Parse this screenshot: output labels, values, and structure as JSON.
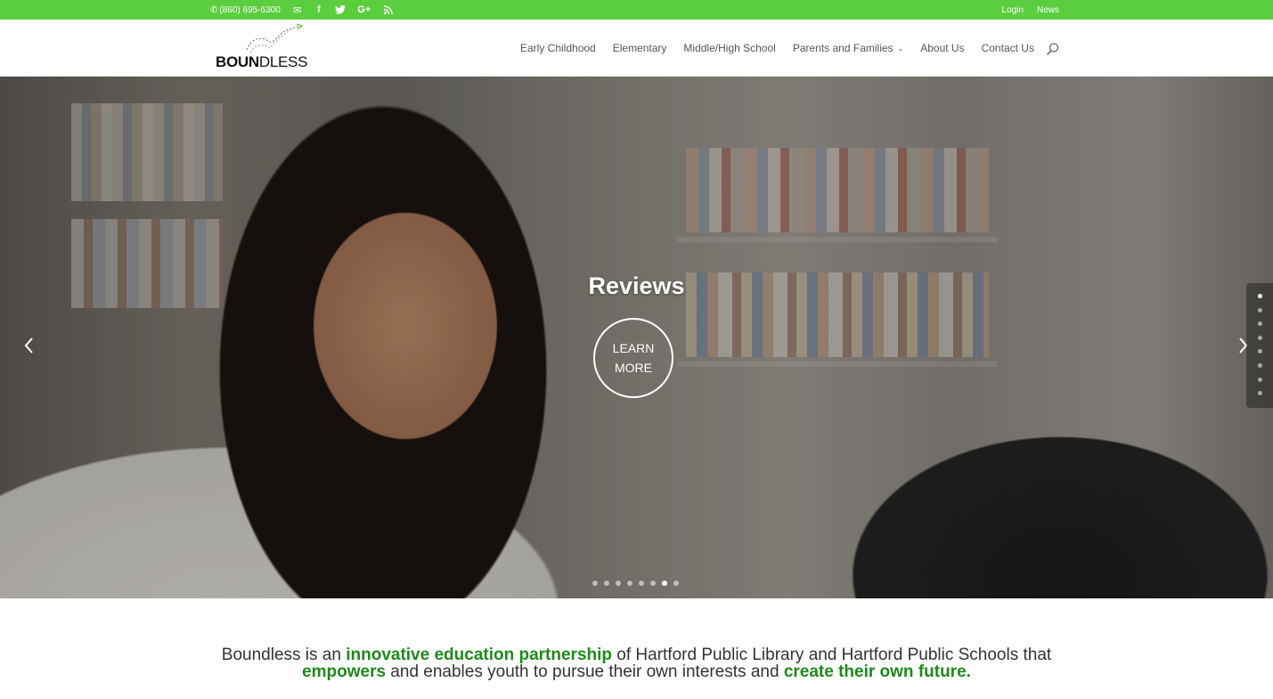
{
  "topbar": {
    "phone": "(860) 695-6300",
    "social_icons": [
      "email-icon",
      "facebook-icon",
      "twitter-icon",
      "google-plus-icon",
      "rss-icon"
    ],
    "links": [
      "Login",
      "News"
    ],
    "background": "#5bce3f"
  },
  "header": {
    "logo_text_bold": "BOUN",
    "logo_text_rest": "DLESS",
    "nav": [
      {
        "label": "Early Childhood"
      },
      {
        "label": "Elementary"
      },
      {
        "label": "Middle/High School"
      },
      {
        "label": "Parents and Families",
        "has_dropdown": true
      },
      {
        "label": "About Us"
      },
      {
        "label": "Contact Us"
      }
    ],
    "search_icon": "search-icon"
  },
  "hero": {
    "title": "Reviews",
    "button_line1": "LEARN",
    "button_line2": "MORE",
    "slide_count": 8,
    "active_slide_index": 6,
    "side_active_index": 0
  },
  "mission": {
    "p1": "Boundless is an ",
    "h1": "innovative education partnership",
    "p2": " of Hartford Public Library and Hartford Public Schools that",
    "h2": "empowers",
    "p3": " and enables youth to pursue their own interests and ",
    "h3": "create their own future.",
    "accent": "#1e8a1a"
  }
}
